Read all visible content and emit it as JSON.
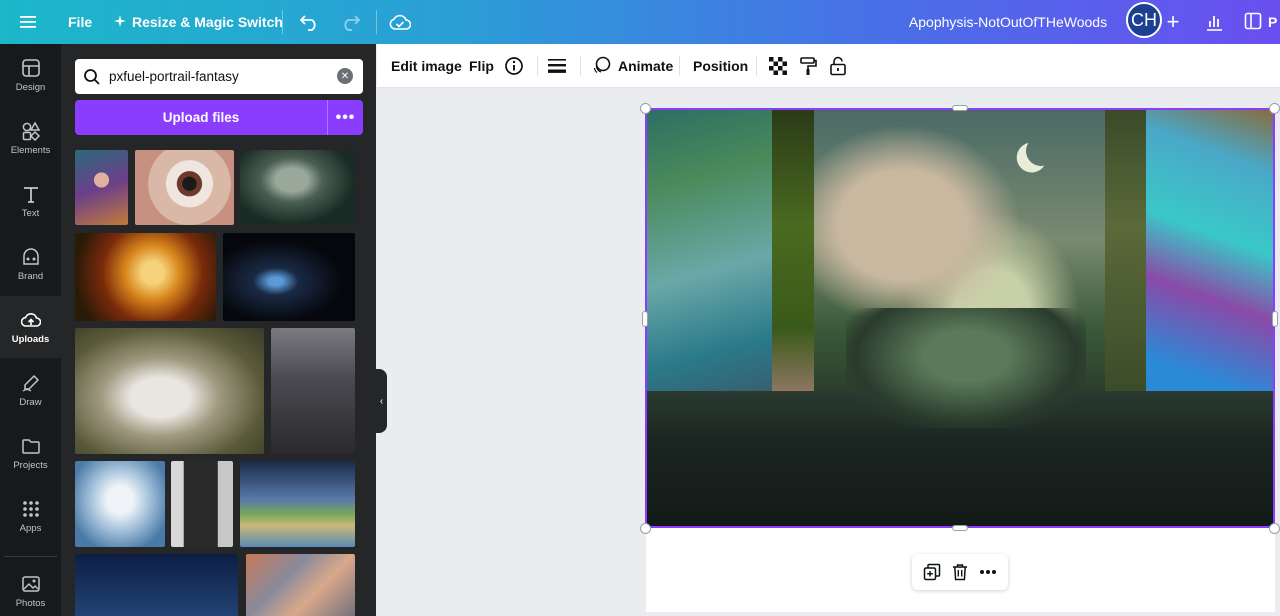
{
  "topbar": {
    "file_label": "File",
    "resize_label": "Resize & Magic Switch",
    "doc_title": "Apophysis-NotOutOfTHeWoods",
    "avatar_initials": "CH",
    "present_label": "P"
  },
  "rail": {
    "items": [
      {
        "label": "Design",
        "icon": "layout-icon"
      },
      {
        "label": "Elements",
        "icon": "shapes-icon"
      },
      {
        "label": "Text",
        "icon": "text-icon"
      },
      {
        "label": "Brand",
        "icon": "brand-icon"
      },
      {
        "label": "Uploads",
        "icon": "cloud-upload-icon",
        "active": true
      },
      {
        "label": "Draw",
        "icon": "pen-icon"
      },
      {
        "label": "Projects",
        "icon": "folder-icon"
      },
      {
        "label": "Apps",
        "icon": "grid-icon"
      },
      {
        "label": "Photos",
        "icon": "photo-icon"
      }
    ]
  },
  "panel": {
    "search_value": "pxfuel-portrail-fantasy",
    "upload_label": "Upload files"
  },
  "context_toolbar": {
    "edit_image": "Edit image",
    "flip": "Flip",
    "animate": "Animate",
    "position": "Position"
  },
  "colors": {
    "accent": "#8b3dff",
    "rail_bg": "#18191b",
    "panel_bg": "#252627"
  }
}
